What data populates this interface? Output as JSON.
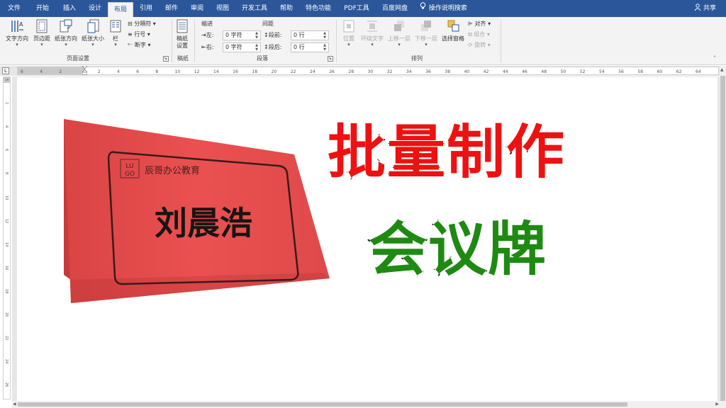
{
  "tabs": [
    {
      "label": "文件"
    },
    {
      "label": "开始"
    },
    {
      "label": "插入"
    },
    {
      "label": "设计"
    },
    {
      "label": "布局"
    },
    {
      "label": "引用"
    },
    {
      "label": "邮件"
    },
    {
      "label": "审阅"
    },
    {
      "label": "视图"
    },
    {
      "label": "开发工具"
    },
    {
      "label": "帮助"
    },
    {
      "label": "特色功能"
    },
    {
      "label": "PDF工具"
    },
    {
      "label": "百度网盘"
    }
  ],
  "active_tab": "布局",
  "search": {
    "label": "操作说明搜索"
  },
  "share": {
    "label": "共享"
  },
  "ribbon": {
    "page_setup": {
      "text_direction": "文字方向",
      "margins": "页边距",
      "orientation": "纸张方向",
      "size": "纸张大小",
      "columns": "栏",
      "breaks": "分隔符",
      "line_numbers": "行号",
      "hyphenation": "断字",
      "group_label": "页面设置"
    },
    "manuscript": {
      "button_line1": "稿纸",
      "button_line2": "设置",
      "group_label": "稿纸"
    },
    "paragraph": {
      "indent_header": "缩进",
      "spacing_header": "间距",
      "left_label": "左:",
      "right_label": "右:",
      "left_value": "0 字符",
      "right_value": "0 字符",
      "before_label": "段前:",
      "after_label": "段后:",
      "before_value": "0 行",
      "after_value": "0 行",
      "group_label": "段落"
    },
    "arrange": {
      "position": "位置",
      "wrap_text": "环绕文字",
      "bring_forward": "上移一层",
      "send_backward": "下移一层",
      "selection_pane": "选择窗格",
      "align": "对齐",
      "group": "组合",
      "rotate": "旋转",
      "group_label": "排列"
    }
  },
  "ruler": {
    "ticks": [
      "6",
      "4",
      "2",
      "",
      "2",
      "4",
      "6",
      "8",
      "10",
      "12",
      "14",
      "16",
      "18",
      "20",
      "22",
      "24",
      "26",
      "28",
      "30",
      "32",
      "34",
      "36",
      "38",
      "40",
      "42",
      "44",
      "46",
      "48",
      "50",
      "52",
      "54",
      "56",
      "58",
      "60",
      "62",
      "64"
    ],
    "vticks": [
      "5",
      "",
      "2",
      "",
      "4",
      "",
      "6",
      "",
      "8",
      "",
      "10",
      "",
      "12",
      "",
      "14",
      "",
      "16",
      "",
      "18",
      "",
      "20",
      "",
      "22",
      "",
      "24",
      "",
      "26"
    ]
  },
  "namecard": {
    "logo_line1": "LU",
    "logo_line2": "GO",
    "company": "辰哥办公教育",
    "person_name": "刘晨浩"
  },
  "headline": {
    "line1": "批量制作",
    "line2": "会议牌"
  },
  "colors": {
    "title_bar": "#2b579a",
    "card_red": "#e84a4a",
    "headline_red": "#ee1111",
    "headline_green": "#1e8a12"
  }
}
